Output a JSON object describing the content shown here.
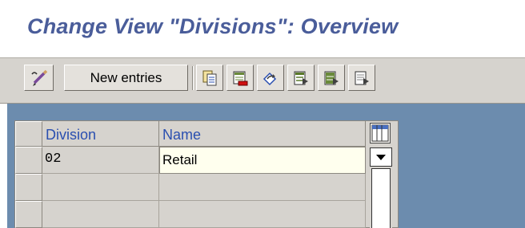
{
  "window": {
    "title": "Change View \"Divisions\": Overview"
  },
  "toolbar": {
    "new_entries_label": "New entries",
    "icons": [
      "display-change-icon",
      "copy-icon",
      "delete-icon",
      "undo-change-icon",
      "select-all-icon",
      "select-block-icon",
      "deselect-all-icon"
    ]
  },
  "table": {
    "columns": [
      "Division",
      "Name"
    ],
    "rows": [
      {
        "division": "02",
        "name": "Retail"
      },
      {
        "division": "",
        "name": ""
      },
      {
        "division": "",
        "name": ""
      }
    ]
  },
  "colors": {
    "title": "#4a5d9a",
    "header_text": "#2a4fb0",
    "background": "#6c8cae",
    "input_field": "#ffffee"
  }
}
